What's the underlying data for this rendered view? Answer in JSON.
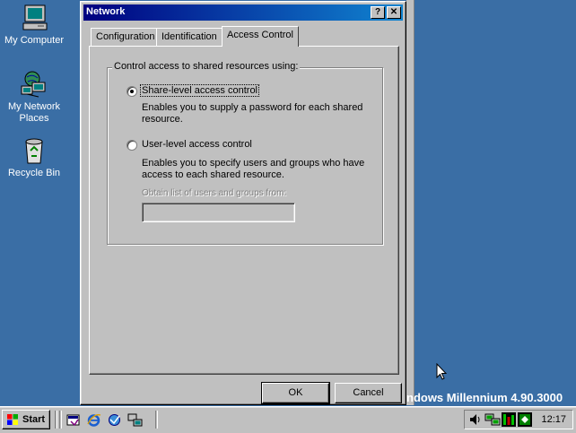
{
  "desktop": {
    "icons": [
      {
        "label": "My Computer"
      },
      {
        "label": "My Network Places"
      },
      {
        "label": "Recycle Bin"
      }
    ],
    "version_text": "ndows Millennium 4.90.3000"
  },
  "dialog": {
    "title": "Network",
    "help_button": "?",
    "close_button": "✕",
    "tabs": [
      {
        "label": "Configuration"
      },
      {
        "label": "Identification"
      },
      {
        "label": "Access Control",
        "active": true
      }
    ],
    "group_label": "Control access to shared resources using:",
    "share_level": {
      "label": "Share-level access control",
      "selected": true,
      "description": "Enables you to supply a password for each shared resource."
    },
    "user_level": {
      "label": "User-level access control",
      "selected": false,
      "description": "Enables you to specify users and groups who have access to each shared resource."
    },
    "obtain_label": "Obtain list of users and groups from:",
    "obtain_value": "",
    "ok_label": "OK",
    "cancel_label": "Cancel"
  },
  "taskbar": {
    "start_label": "Start",
    "clock": "12:17"
  }
}
